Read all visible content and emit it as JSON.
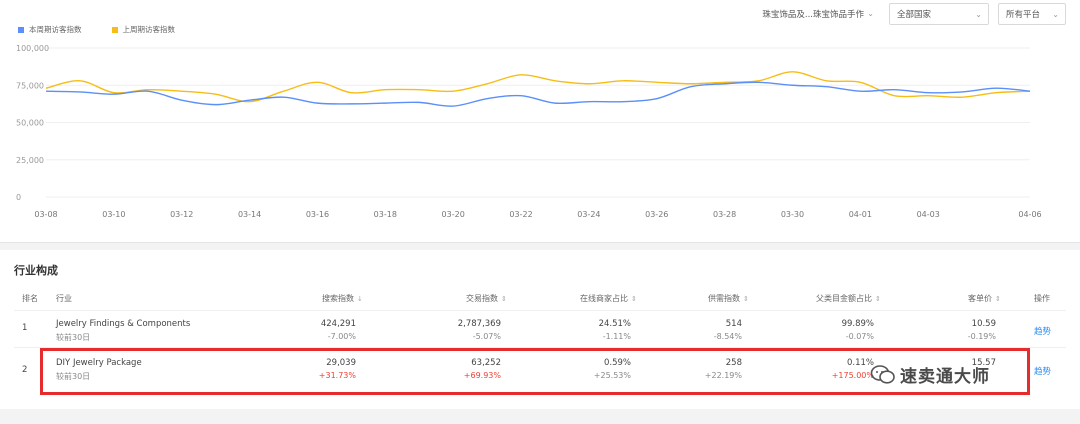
{
  "filters": {
    "category": "珠宝饰品及...珠宝饰品手作",
    "country": "全部国家",
    "platform": "所有平台"
  },
  "legend": {
    "current": "本周期访客指数",
    "previous": "上周期访客指数"
  },
  "colors": {
    "current": "#5b8ff9",
    "previous": "#f6bd16",
    "positive": "#f04134",
    "link": "#2d8cf0",
    "highlight": "#e52b2b"
  },
  "chart_data": {
    "type": "line",
    "x": [
      "03-08",
      "03-09",
      "03-10",
      "03-11",
      "03-12",
      "03-13",
      "03-14",
      "03-15",
      "03-16",
      "03-17",
      "03-18",
      "03-19",
      "03-20",
      "03-21",
      "03-22",
      "03-23",
      "03-24",
      "03-25",
      "03-26",
      "03-27",
      "03-28",
      "03-29",
      "03-30",
      "03-31",
      "04-01",
      "04-02",
      "04-03",
      "04-04",
      "04-05",
      "04-06"
    ],
    "x_tick_labels": [
      "03-08",
      "03-10",
      "03-12",
      "03-14",
      "03-16",
      "03-18",
      "03-20",
      "03-22",
      "03-24",
      "03-26",
      "03-28",
      "03-30",
      "04-01",
      "04-03",
      "04-06"
    ],
    "y_tick_labels": [
      "100,000",
      "75,000",
      "50,000",
      "25,000",
      "0"
    ],
    "ylim": [
      0,
      100000
    ],
    "series": [
      {
        "name": "本周期访客指数",
        "values": [
          71000,
          70500,
          69000,
          71000,
          65000,
          62000,
          65000,
          67000,
          63000,
          62500,
          63000,
          63500,
          61000,
          66000,
          68000,
          63000,
          64000,
          64000,
          66000,
          74000,
          76000,
          77000,
          75000,
          74000,
          71000,
          72000,
          70000,
          70500,
          73000,
          71000
        ]
      },
      {
        "name": "上周期访客指数",
        "values": [
          73000,
          78000,
          70000,
          72000,
          71000,
          69000,
          64000,
          71000,
          77000,
          70000,
          72000,
          72000,
          71000,
          76000,
          82000,
          78000,
          76000,
          78000,
          77000,
          76000,
          77000,
          78000,
          84000,
          78000,
          77000,
          68000,
          68000,
          67000,
          70000,
          71000
        ]
      }
    ],
    "grid": true
  },
  "industry": {
    "title": "行业构成",
    "headers": {
      "rank": "排名",
      "industry": "行业",
      "search": "搜索指数",
      "trade": "交易指数",
      "online_seller": "在线商家占比",
      "supply": "供需指数",
      "parent_amount": "父类目金额占比",
      "unit_price": "客单价",
      "action": "操作"
    },
    "rows": [
      {
        "rank": "1",
        "name": "Jewelry Findings & Components",
        "period": "较前30日",
        "search": "424,291",
        "search_chg": "-7.00%",
        "trade": "2,787,369",
        "trade_chg": "-5.07%",
        "online_seller": "24.51%",
        "online_seller_chg": "-1.11%",
        "supply": "514",
        "supply_chg": "-8.54%",
        "parent_amount": "99.89%",
        "parent_amount_chg": "-0.07%",
        "unit_price": "10.59",
        "unit_price_chg": "-0.19%",
        "action": "趋势"
      },
      {
        "rank": "2",
        "name": "DIY Jewelry Package",
        "period": "较前30日",
        "search": "29,039",
        "search_chg": "+31.73%",
        "trade": "63,252",
        "trade_chg": "+69.93%",
        "online_seller": "0.59%",
        "online_seller_chg": "+25.53%",
        "supply": "258",
        "supply_chg": "+22.19%",
        "parent_amount": "0.11%",
        "parent_amount_chg": "+175.00%",
        "unit_price": "15.57",
        "unit_price_chg": "",
        "action": "趋势"
      }
    ]
  },
  "watermark": {
    "text": "速卖通大师"
  }
}
